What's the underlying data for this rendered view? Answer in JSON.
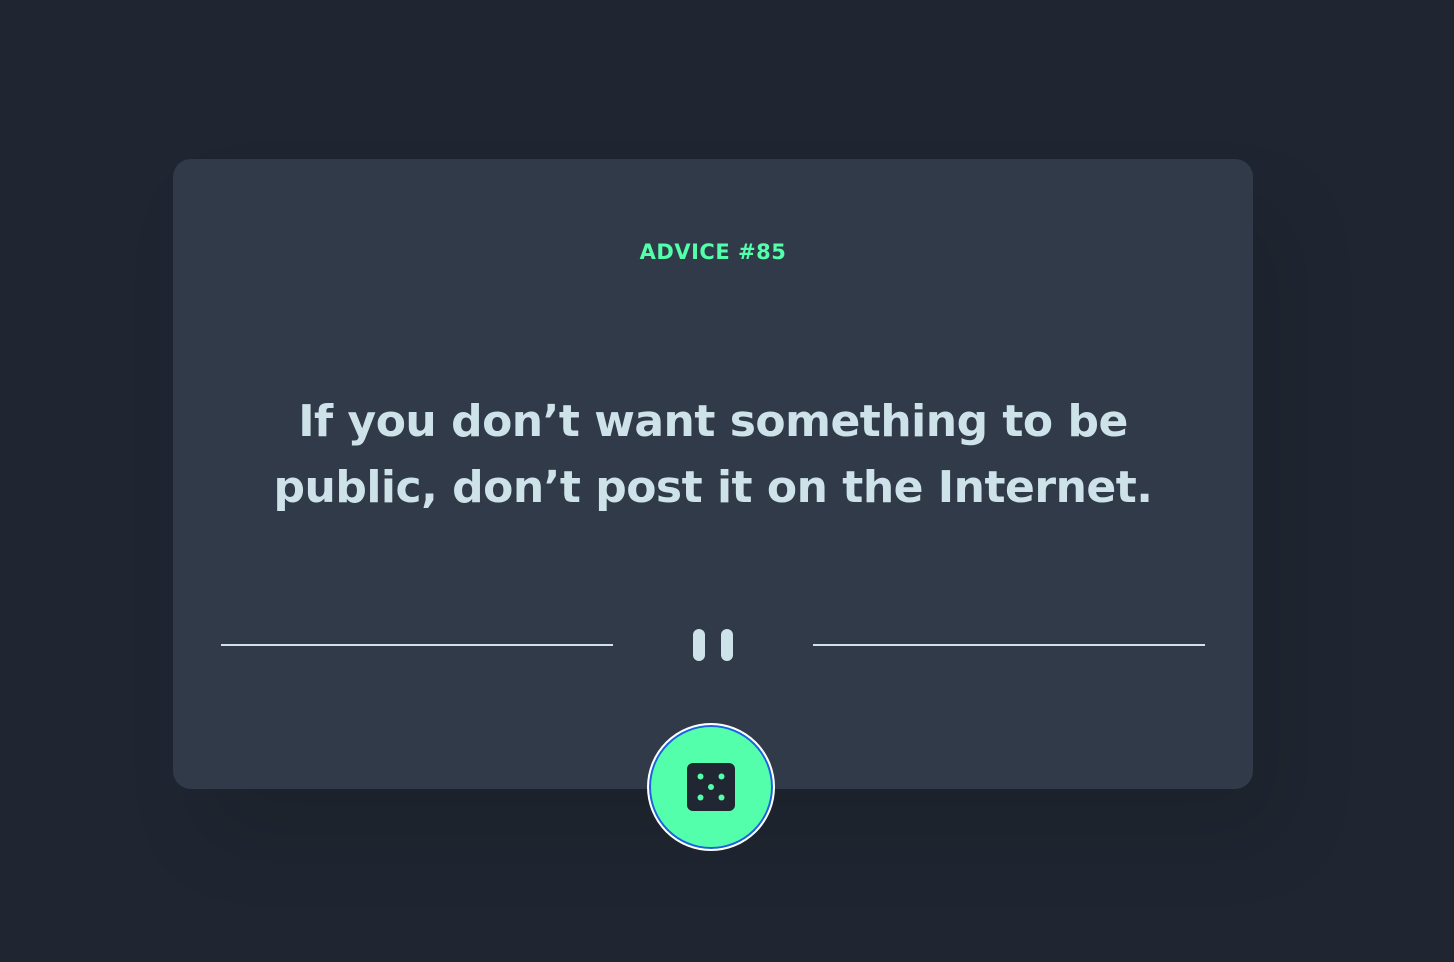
{
  "advice": {
    "label": "ADVICE #85",
    "quote": "If you don’t want something to be public, don’t post it on the Internet."
  },
  "icons": {
    "divider_icon": "pause-icon",
    "button_icon": "dice-icon"
  },
  "colors": {
    "background": "#1f2631",
    "card": "#313a48",
    "accent": "#53ffaa",
    "text": "#cee3e9"
  }
}
